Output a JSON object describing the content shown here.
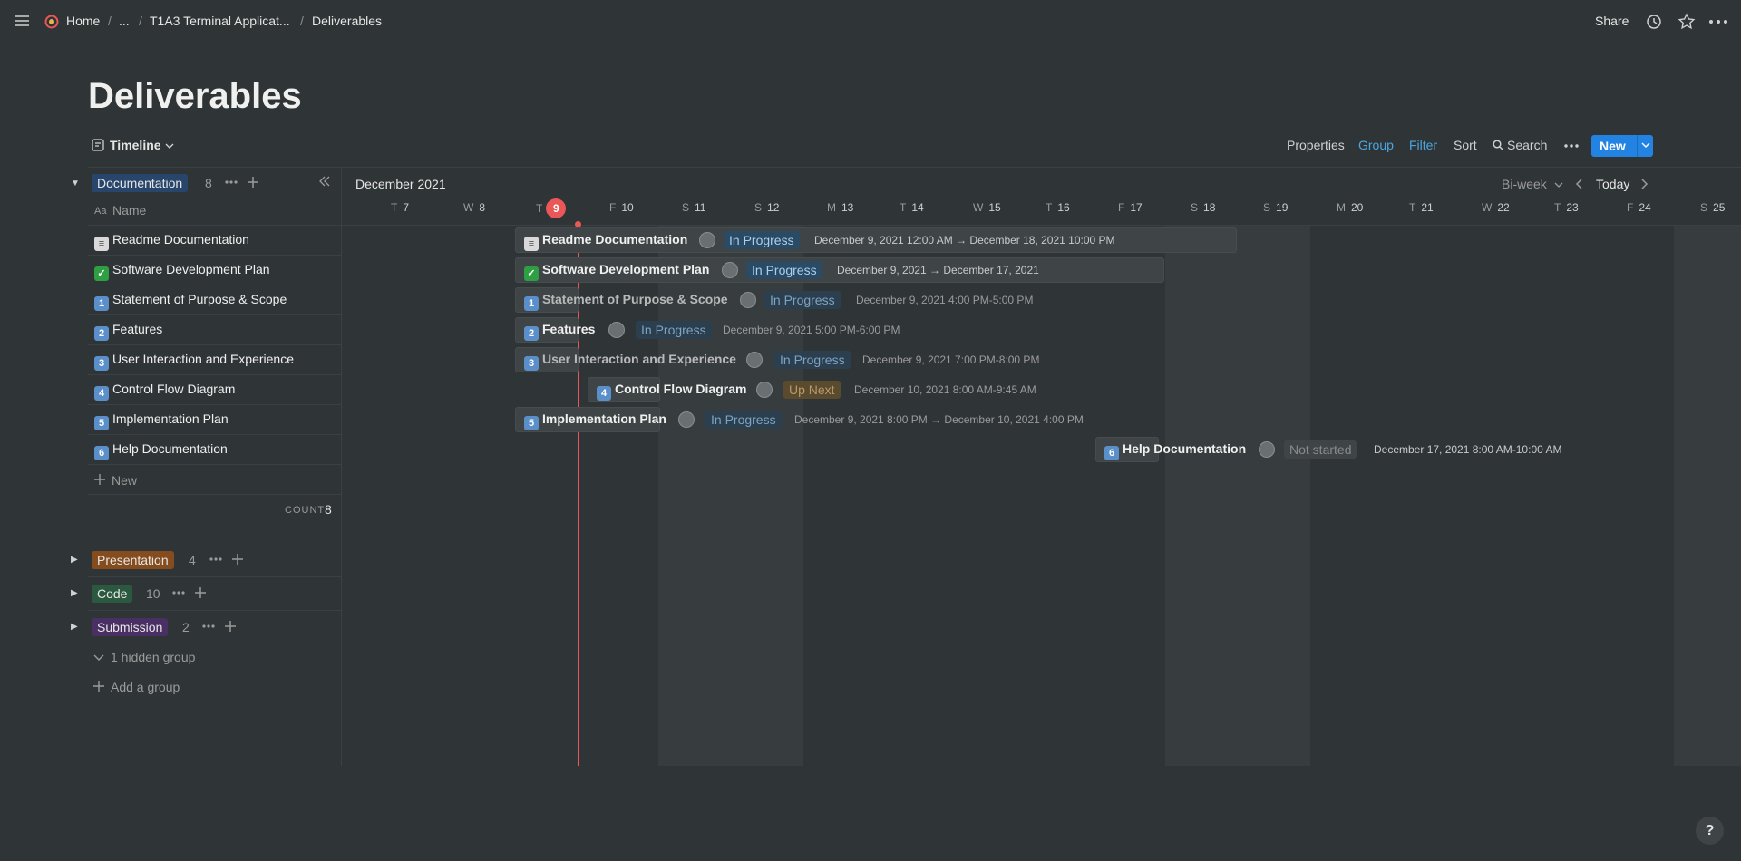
{
  "breadcrumb": {
    "home": "Home",
    "ellipsis": "...",
    "parent": "T1A3 Terminal Applicat...",
    "current": "Deliverables",
    "separator": "/"
  },
  "topbar": {
    "share": "Share"
  },
  "page": {
    "title": "Deliverables"
  },
  "toolbar": {
    "view": "Timeline",
    "properties": "Properties",
    "group": "Group",
    "filter": "Filter",
    "sort": "Sort",
    "search": "Search",
    "new": "New"
  },
  "timeline": {
    "month": "December 2021",
    "scale": "Bi-week",
    "today": "Today",
    "days": [
      {
        "d": "T",
        "n": "7"
      },
      {
        "d": "W",
        "n": "8"
      },
      {
        "d": "T",
        "n": "9"
      },
      {
        "d": "F",
        "n": "10"
      },
      {
        "d": "S",
        "n": "11"
      },
      {
        "d": "S",
        "n": "12"
      },
      {
        "d": "M",
        "n": "13"
      },
      {
        "d": "T",
        "n": "14"
      },
      {
        "d": "W",
        "n": "15"
      },
      {
        "d": "T",
        "n": "16"
      },
      {
        "d": "F",
        "n": "17"
      },
      {
        "d": "S",
        "n": "18"
      },
      {
        "d": "S",
        "n": "19"
      },
      {
        "d": "M",
        "n": "20"
      },
      {
        "d": "T",
        "n": "21"
      },
      {
        "d": "W",
        "n": "22"
      },
      {
        "d": "T",
        "n": "23"
      },
      {
        "d": "F",
        "n": "24"
      },
      {
        "d": "S",
        "n": "25"
      }
    ]
  },
  "groups": {
    "documentation": {
      "label": "Documentation",
      "count": "8",
      "color": "#28456c"
    },
    "presentation": {
      "label": "Presentation",
      "count": "4",
      "color": "#854c1d"
    },
    "code": {
      "label": "Code",
      "count": "10",
      "color": "#2b593f"
    },
    "submission": {
      "label": "Submission",
      "count": "2",
      "color": "#492f64"
    }
  },
  "column": {
    "name": "Name"
  },
  "items": [
    {
      "icon": "doc",
      "name": "Readme Documentation",
      "status": "In Progress",
      "dates": "December 9, 2021 12:00 AM → December 18, 2021 10:00 PM"
    },
    {
      "icon": "check",
      "name": "Software Development Plan",
      "status": "In Progress",
      "dates": "December 9, 2021 → December 17, 2021"
    },
    {
      "icon": "1",
      "name": "Statement of Purpose & Scope",
      "status": "In Progress",
      "dates": "December 9, 2021 4:00 PM-5:00 PM"
    },
    {
      "icon": "2",
      "name": "Features",
      "status": "In Progress",
      "dates": "December 9, 2021 5:00 PM-6:00 PM"
    },
    {
      "icon": "3",
      "name": "User Interaction and Experience",
      "status": "In Progress",
      "dates": "December 9, 2021 7:00 PM-8:00 PM"
    },
    {
      "icon": "4",
      "name": "Control Flow Diagram",
      "status": "Up Next",
      "dates": "December 10, 2021 8:00 AM-9:45 AM"
    },
    {
      "icon": "5",
      "name": "Implementation Plan",
      "status": "In Progress",
      "dates": "December 9, 2021 8:00 PM → December 10, 2021 4:00 PM"
    },
    {
      "icon": "6",
      "name": "Help Documentation",
      "status": "Not started",
      "dates": "December 17, 2021 8:00 AM-10:00 AM"
    }
  ],
  "list": {
    "new": "New",
    "count_label": "COUNT",
    "count_value": "8",
    "hidden_group": "1 hidden group",
    "add_group": "Add a group"
  },
  "help": "?"
}
